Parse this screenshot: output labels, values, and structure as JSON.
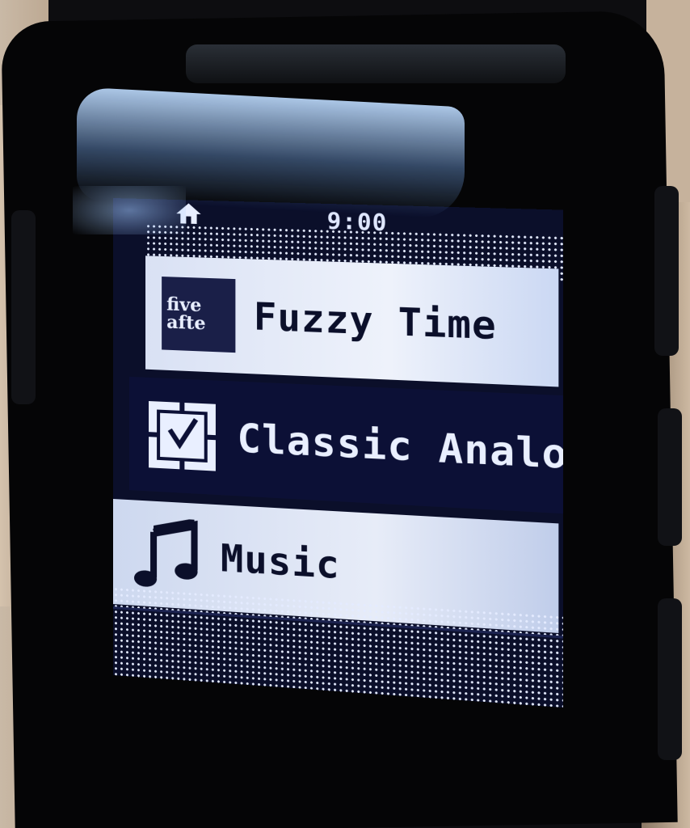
{
  "status_bar": {
    "time": "9:00",
    "home_icon": "home-icon"
  },
  "menu": {
    "items": [
      {
        "label": "Fuzzy Time",
        "icon": "fuzzy-time-icon",
        "icon_text_line1": "five",
        "icon_text_line2": "afte",
        "selected": false
      },
      {
        "label": "Classic Analog",
        "icon": "analog-clock-icon",
        "selected": true
      },
      {
        "label": "Music",
        "icon": "music-note-icon",
        "selected": false
      }
    ]
  },
  "colors": {
    "screen_bg": "#0b0f2a",
    "highlight": "#0c1036",
    "item_bg": "#e3e9f7",
    "text_dark": "#0b0f2a",
    "text_light": "#e9efff"
  }
}
